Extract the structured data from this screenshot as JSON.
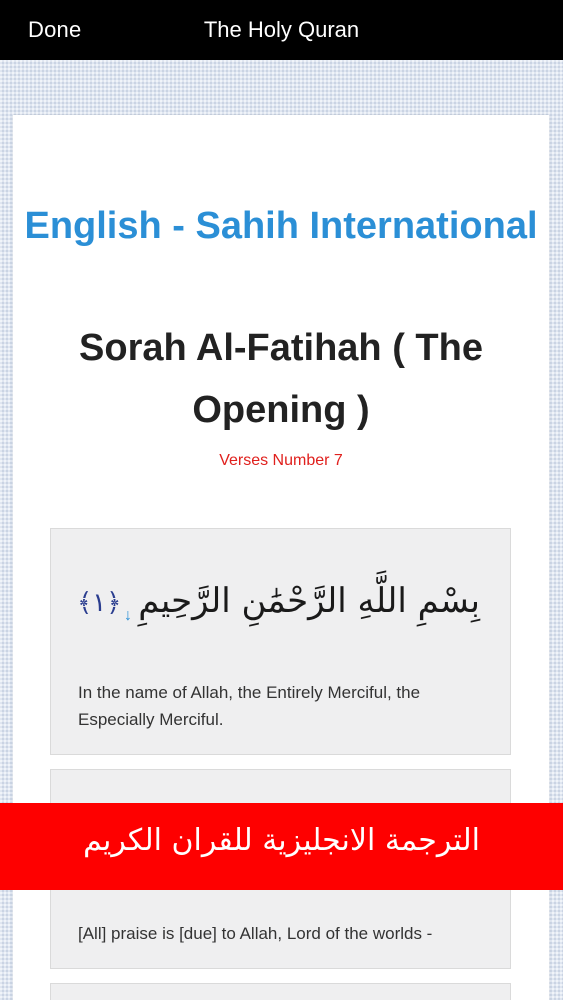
{
  "navbar": {
    "done_label": "Done",
    "title": "The Holy Quran"
  },
  "header": {
    "translation_title": "English - Sahih International",
    "sura_title": "Sorah Al-Fatihah ( The Opening )",
    "verses_count": "Verses Number 7"
  },
  "verses": [
    {
      "arabic": "بِسْمِ اللَّهِ الرَّحْمَٰنِ الرَّحِيمِ",
      "ayah_marker": "﴿١﴾",
      "english": "In the name of Allah, the Entirely Merciful, the Especially Merciful."
    },
    {
      "english": "[All] praise is [due] to Allah, Lord of the worlds -"
    }
  ],
  "icons": {
    "download": "download-arrow-icon"
  },
  "banner": {
    "text": "الترجمة الانجليزية للقران الكريم"
  },
  "colors": {
    "accent": "#2b8fd6",
    "verses_count": "#e0201d",
    "banner_background": "#fe0000",
    "navbar_background": "#000000"
  }
}
